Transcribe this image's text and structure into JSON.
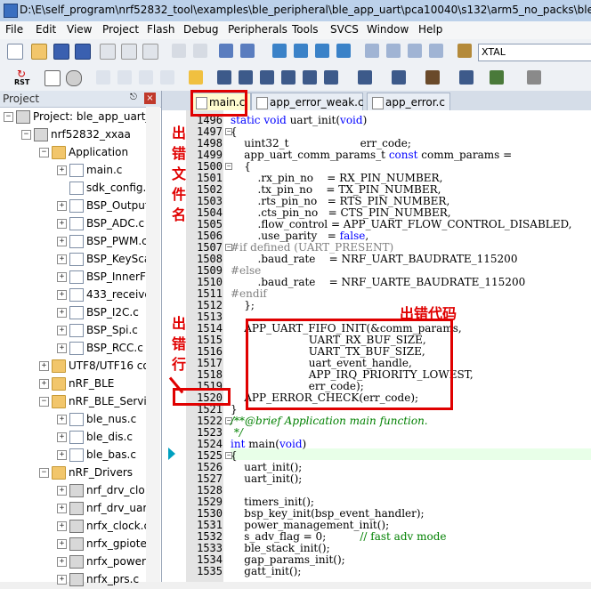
{
  "window": {
    "title": "D:\\E\\self_program\\nrf52832_tool\\examples\\ble_peripheral\\ble_app_uart\\pca10040\\s132\\arm5_no_packs\\ble_ap"
  },
  "menu": [
    "File",
    "Edit",
    "View",
    "Project",
    "Flash",
    "Debug",
    "Peripherals",
    "Tools",
    "SVCS",
    "Window",
    "Help"
  ],
  "toolbar": {
    "target_combo": "XTAL",
    "rst_label": "RST"
  },
  "project_panel": {
    "title": "Project",
    "pin": "p",
    "close": "×",
    "items": [
      {
        "text": "Project: ble_app_uart_p",
        "level": 0,
        "kind": "project",
        "expander": "−"
      },
      {
        "text": "nrf52832_xxaa",
        "level": 1,
        "kind": "target",
        "expander": "−"
      },
      {
        "text": "Application",
        "level": 2,
        "kind": "folder",
        "expander": "−"
      },
      {
        "text": "main.c",
        "level": 3,
        "kind": "file-plus",
        "expander": "+"
      },
      {
        "text": "sdk_config.",
        "level": 3,
        "kind": "file",
        "expander": ""
      },
      {
        "text": "BSP_Output",
        "level": 3,
        "kind": "file-plus",
        "expander": "+"
      },
      {
        "text": "BSP_ADC.c",
        "level": 3,
        "kind": "file-plus",
        "expander": "+"
      },
      {
        "text": "BSP_PWM.c",
        "level": 3,
        "kind": "file-plus",
        "expander": "+"
      },
      {
        "text": "BSP_KeySca",
        "level": 3,
        "kind": "file-plus",
        "expander": "+"
      },
      {
        "text": "BSP_InnerFl",
        "level": 3,
        "kind": "file-plus",
        "expander": "+"
      },
      {
        "text": "433_receive",
        "level": 3,
        "kind": "file-plus",
        "expander": "+"
      },
      {
        "text": "BSP_I2C.c",
        "level": 3,
        "kind": "file-plus",
        "expander": "+"
      },
      {
        "text": "BSP_Spi.c",
        "level": 3,
        "kind": "file-plus",
        "expander": "+"
      },
      {
        "text": "BSP_RCC.c",
        "level": 3,
        "kind": "file-plus",
        "expander": "+"
      },
      {
        "text": "UTF8/UTF16 co",
        "level": 2,
        "kind": "folder",
        "expander": "+"
      },
      {
        "text": "nRF_BLE",
        "level": 2,
        "kind": "folder",
        "expander": "+"
      },
      {
        "text": "nRF_BLE_Servic",
        "level": 2,
        "kind": "folder",
        "expander": "−"
      },
      {
        "text": "ble_nus.c",
        "level": 3,
        "kind": "file-plus",
        "expander": "+"
      },
      {
        "text": "ble_dis.c",
        "level": 3,
        "kind": "file-plus",
        "expander": "+"
      },
      {
        "text": "ble_bas.c",
        "level": 3,
        "kind": "file-plus",
        "expander": "+"
      },
      {
        "text": "nRF_Drivers",
        "level": 2,
        "kind": "folder",
        "expander": "−"
      },
      {
        "text": "nrf_drv_clo",
        "level": 3,
        "kind": "gear",
        "expander": "+"
      },
      {
        "text": "nrf_drv_uar",
        "level": 3,
        "kind": "gear",
        "expander": "+"
      },
      {
        "text": "nrfx_clock.c",
        "level": 3,
        "kind": "gear",
        "expander": "+"
      },
      {
        "text": "nrfx_gpiote",
        "level": 3,
        "kind": "gear",
        "expander": "+"
      },
      {
        "text": "nrfx_power",
        "level": 3,
        "kind": "gear",
        "expander": "+"
      },
      {
        "text": "nrfx_prs.c",
        "level": 3,
        "kind": "gear",
        "expander": "+"
      }
    ]
  },
  "tabs": [
    {
      "label": "main.c",
      "active": true
    },
    {
      "label": "app_error_weak.c",
      "active": false
    },
    {
      "label": "app_error.c",
      "active": false
    }
  ],
  "code_lines": [
    {
      "n": "1496",
      "text": "static void uart_init(void)",
      "type": "kw-fn"
    },
    {
      "n": "1497",
      "text": "{",
      "type": "plain",
      "fold": "−"
    },
    {
      "n": "1498",
      "text": "    uint32_t                     err_code;",
      "type": "plain"
    },
    {
      "n": "1499",
      "text": "    app_uart_comm_params_t const comm_params =",
      "type": "const"
    },
    {
      "n": "1500",
      "text": "    {",
      "type": "plain",
      "fold": "−"
    },
    {
      "n": "1501",
      "text": "        .rx_pin_no    = RX_PIN_NUMBER,",
      "type": "plain"
    },
    {
      "n": "1502",
      "text": "        .tx_pin_no    = TX_PIN_NUMBER,",
      "type": "plain"
    },
    {
      "n": "1503",
      "text": "        .rts_pin_no   = RTS_PIN_NUMBER,",
      "type": "plain"
    },
    {
      "n": "1504",
      "text": "        .cts_pin_no   = CTS_PIN_NUMBER,",
      "type": "plain"
    },
    {
      "n": "1505",
      "text": "        .flow_control = APP_UART_FLOW_CONTROL_DISABLED,",
      "type": "plain"
    },
    {
      "n": "1506",
      "text": "        .use_parity   = false,",
      "type": "false"
    },
    {
      "n": "1507",
      "text": "#if defined (UART_PRESENT)",
      "type": "pp",
      "fold": "−"
    },
    {
      "n": "1508",
      "text": "        .baud_rate    = NRF_UART_BAUDRATE_115200",
      "type": "plain"
    },
    {
      "n": "1509",
      "text": "#else",
      "type": "pp"
    },
    {
      "n": "1510",
      "text": "        .baud_rate    = NRF_UARTE_BAUDRATE_115200",
      "type": "plain"
    },
    {
      "n": "1511",
      "text": "#endif",
      "type": "pp"
    },
    {
      "n": "1512",
      "text": "    };",
      "type": "plain"
    },
    {
      "n": "1513",
      "text": "",
      "type": "plain"
    },
    {
      "n": "1514",
      "text": "    APP_UART_FIFO_INIT(&comm_params,",
      "type": "plain"
    },
    {
      "n": "1515",
      "text": "                       UART_RX_BUF_SIZE,",
      "type": "plain"
    },
    {
      "n": "1516",
      "text": "                       UART_TX_BUF_SIZE,",
      "type": "plain"
    },
    {
      "n": "1517",
      "text": "                       uart_event_handle,",
      "type": "plain"
    },
    {
      "n": "1518",
      "text": "                       APP_IRQ_PRIORITY_LOWEST,",
      "type": "plain"
    },
    {
      "n": "1519",
      "text": "                       err_code);",
      "type": "plain"
    },
    {
      "n": "1520",
      "text": "    APP_ERROR_CHECK(err_code);",
      "type": "plain"
    },
    {
      "n": "1521",
      "text": "}",
      "type": "plain"
    },
    {
      "n": "1522",
      "text": "/**@brief Application main function.",
      "type": "cm",
      "fold": "−"
    },
    {
      "n": "1523",
      "text": " */",
      "type": "cm"
    },
    {
      "n": "1524",
      "text": "int main(void)",
      "type": "kw-int"
    },
    {
      "n": "1525",
      "text": "{",
      "type": "plain",
      "fold": "−"
    },
    {
      "n": "1526",
      "text": "    uart_init();",
      "type": "plain"
    },
    {
      "n": "1527",
      "text": "    uart_init();",
      "type": "plain"
    },
    {
      "n": "1528",
      "text": "",
      "type": "plain"
    },
    {
      "n": "1529",
      "text": "    timers_init();",
      "type": "plain"
    },
    {
      "n": "1530",
      "text": "    bsp_key_init(bsp_event_handler);",
      "type": "plain"
    },
    {
      "n": "1531",
      "text": "    power_management_init();",
      "type": "plain"
    },
    {
      "n": "1532",
      "text": "    s_adv_flag = 0;          // fast adv mode",
      "type": "comment-tail"
    },
    {
      "n": "1533",
      "text": "    ble_stack_init();",
      "type": "plain"
    },
    {
      "n": "1534",
      "text": "    gap_params_init();",
      "type": "plain"
    },
    {
      "n": "1535",
      "text": "    gatt_init();",
      "type": "plain"
    }
  ],
  "annotations": {
    "file_name": "出\n错\n文\n件\n名",
    "error_code": "出错代码",
    "error_line": "出\n错\n行"
  },
  "colors": {
    "annotation_red": "#e00000",
    "keyword_blue": "#0000ff",
    "comment_green": "#008000",
    "preprocessor_gray": "#808080"
  }
}
